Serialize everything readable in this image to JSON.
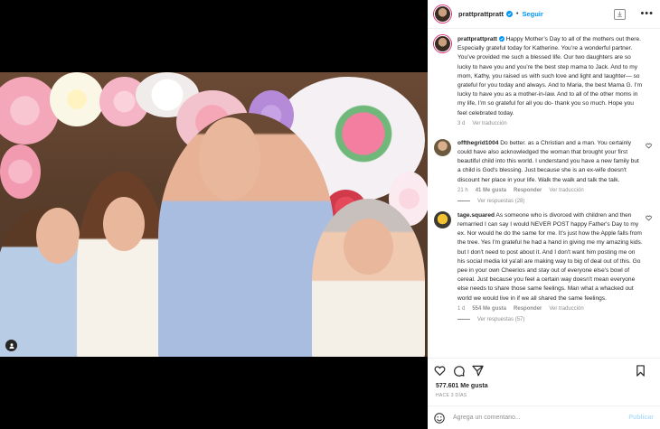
{
  "post": {
    "username": "prattprattpratt",
    "follow_label": "Seguir",
    "dot": "•",
    "caption": "Happy Mother’s Day to all of the mothers out there. Especially grateful today for Katherine. You’re a wonderful partner. You’ve provided me such a blessed life. Our two daughters are so lucky to have you and you’re the best step mama to Jack. And to my mom, Kathy, you raised us with such love and light and laughter— so grateful for you today and always. And to Maria, the best Mama G. I’m lucky to have you as a mother-in-law. And to all of the other moms in my life, I’m so grateful for all you do- thank you so much. Hope you feel celebrated today.",
    "caption_time": "3 d",
    "caption_translate": "Ver traducción"
  },
  "comments": [
    {
      "username": "offthegrid1004",
      "text": "Do better. as a Christian and a man. You certainly could have also acknowledged the woman that brought your first beautiful child into this world. I understand you have a new family but a child is God's blessing. Just because she is an ex-wife doesn't discount her place in your life. Walk the walk and talk the talk.",
      "time": "21 h",
      "likes": "41 Me gusta",
      "reply": "Responder",
      "translate": "Ver traducción",
      "replies": "Ver respuestas (28)"
    },
    {
      "username": "tage.squared",
      "text": "As someone who is divorced with children and then remarried I can say I would NEVER POST happy Father's Day to my ex. Nor would he do the same for me. It's just how the Apple falls from the tree. Yes I'm grateful he had a hand in giving me my amazing kids. but I don't need to post about it. And I don't want him posting me on his social media lol ya'all are making way to big of deal out of this. Go pee in your own Cheerios and stay out of everyone else's bowl of cereal. Just because you feel a certain way doesn't mean everyone else needs to share those same feelings. Man what a whacked out world we would live in if we all shared the same feelings.",
      "time": "1 d",
      "likes": "554 Me gusta",
      "reply": "Responder",
      "translate": "Ver traducción",
      "replies": "Ver respuestas (57)"
    }
  ],
  "footer": {
    "likes": "577.601 Me gusta",
    "ago": "HACE 3 DÍAS",
    "comment_placeholder": "Agrega un comentario...",
    "publish_label": "Publicar"
  },
  "colors": {
    "accent": "#0095f6",
    "publish_disabled": "#b2dffc",
    "muted": "#8e8e8e"
  },
  "icons": [
    "verified-badge-icon",
    "download-icon",
    "more-options-icon",
    "heart-icon",
    "comment-icon",
    "share-icon",
    "save-bookmark-icon",
    "emoji-icon",
    "user-tag-icon"
  ]
}
